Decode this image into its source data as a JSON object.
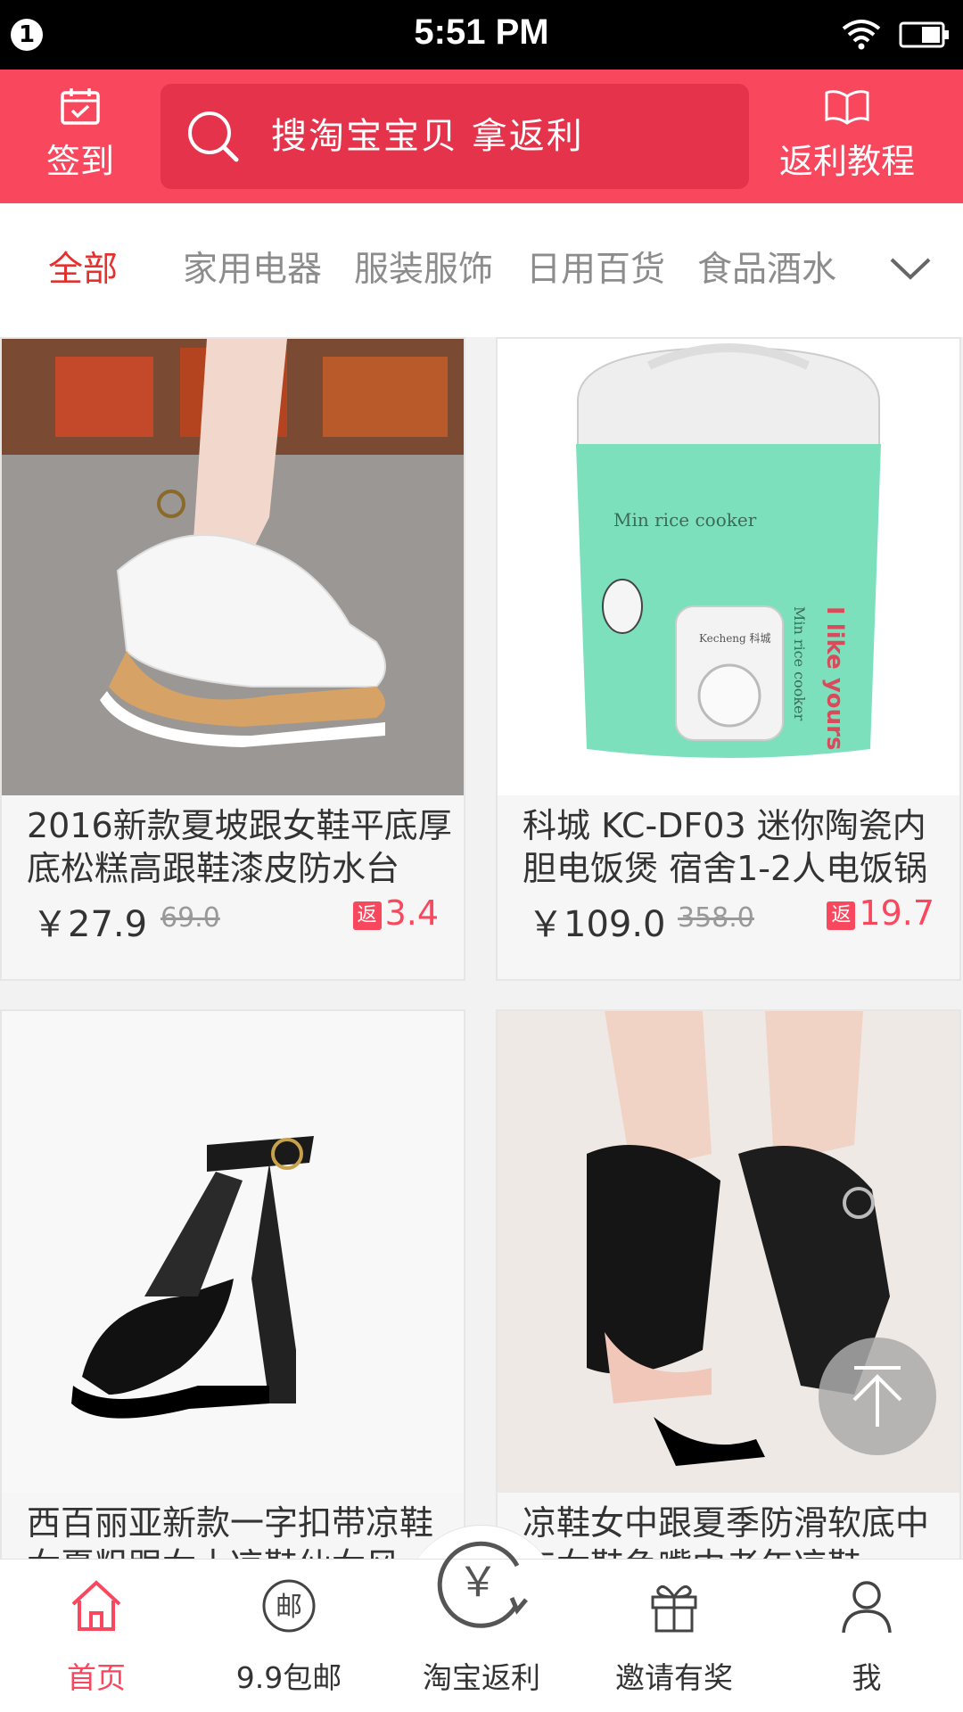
{
  "status_bar": {
    "notification_count": "1",
    "time": "5:51 PM"
  },
  "header": {
    "checkin_label": "签到",
    "search_placeholder": "搜淘宝宝贝  拿返利",
    "tutorial_label": "返利教程"
  },
  "categories": {
    "items": [
      "全部",
      "家用电器",
      "服装服饰",
      "日用百货",
      "食品酒水"
    ],
    "active_index": 0
  },
  "products": [
    {
      "title": "2016新款夏坡跟女鞋平底厚底松糕高跟鞋漆皮防水台",
      "price": "￥27.9",
      "original_price": "69.0",
      "rebate_tag": "返",
      "rebate": "3.4"
    },
    {
      "title": "科城 KC-DF03 迷你陶瓷内胆电饭煲 宿舍1-2人电饭锅",
      "price": "￥109.0",
      "original_price": "358.0",
      "rebate_tag": "返",
      "rebate": "19.7"
    },
    {
      "title": "西百丽亚新款一字扣带凉鞋女夏粗跟女士凉鞋仙女风",
      "price": "",
      "original_price": "",
      "rebate_tag": "",
      "rebate": ""
    },
    {
      "title": "凉鞋女中跟夏季防滑软底中年女鞋鱼嘴中老年凉鞋",
      "price": "",
      "original_price": "",
      "rebate_tag": "",
      "rebate": ""
    }
  ],
  "product_images": {
    "p1": "Min rice cooker",
    "p2": "I like yours",
    "p3": "Min rice cooker",
    "p4": "Kecheng 科城"
  },
  "tabbar": {
    "items": [
      {
        "label": "首页",
        "icon": "home-icon",
        "active": true
      },
      {
        "label": "9.9包邮",
        "icon": "mail-icon",
        "glyph": "邮"
      },
      {
        "label": "淘宝返利",
        "icon": "yen-refresh-icon",
        "glyph": "￥"
      },
      {
        "label": "邀请有奖",
        "icon": "gift-icon"
      },
      {
        "label": "我",
        "icon": "user-icon"
      }
    ]
  },
  "colors": {
    "accent": "#f9475e",
    "search_bg": "#e4334b",
    "active_tab": "#e5312e",
    "rice_cooker_green": "#7de0bd"
  }
}
